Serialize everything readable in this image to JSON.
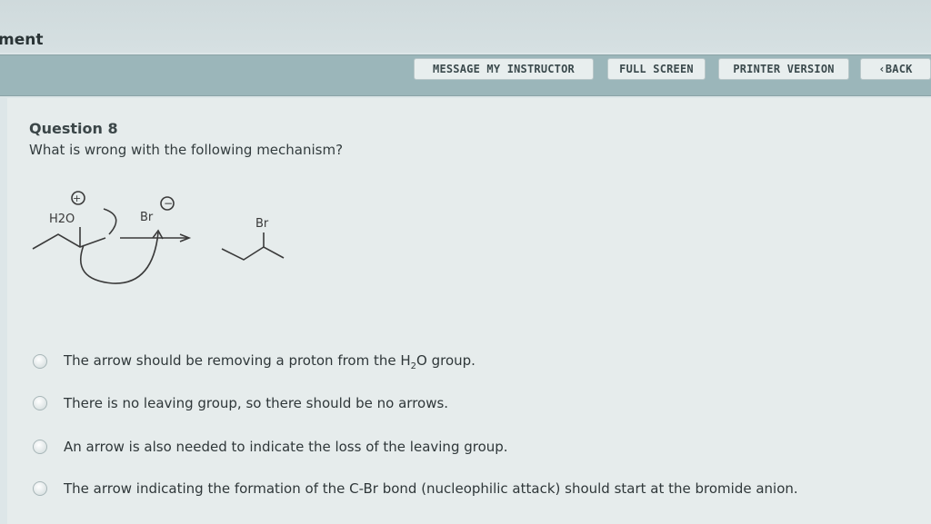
{
  "header": {
    "title": "ment"
  },
  "toolbar": {
    "message_label": "MESSAGE MY INSTRUCTOR",
    "fullscreen_label": "FULL SCREEN",
    "printer_label": "PRINTER VERSION",
    "back_label": "BACK"
  },
  "question": {
    "number": "Question 8",
    "text": "What is wrong with the following mechanism?"
  },
  "mechanism": {
    "reactant_leaving_group": "H2O",
    "nucleophile": "Br",
    "product_substituent": "Br"
  },
  "options": [
    {
      "prefix": "The arrow should be removing a proton from the H",
      "sub": "2",
      "suffix": "O group."
    },
    {
      "text": "There is no leaving group, so there should be no arrows."
    },
    {
      "text": "An arrow is also needed to indicate the loss of the leaving group."
    },
    {
      "text": "The arrow indicating the formation of the C-Br bond (nucleophilic attack) should start at the bromide anion."
    }
  ]
}
